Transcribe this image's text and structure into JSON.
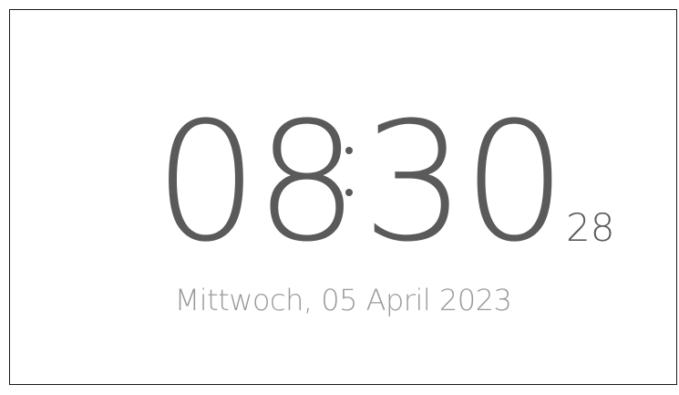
{
  "clock": {
    "hours": "08",
    "minutes": "30",
    "seconds": "28",
    "separator": ":",
    "date": "Mittwoch, 05 April 2023"
  },
  "colors": {
    "time": "#5a5a5a",
    "date": "#9a9a9a",
    "frame_border": "#1a1a1a",
    "background": "#ffffff"
  }
}
